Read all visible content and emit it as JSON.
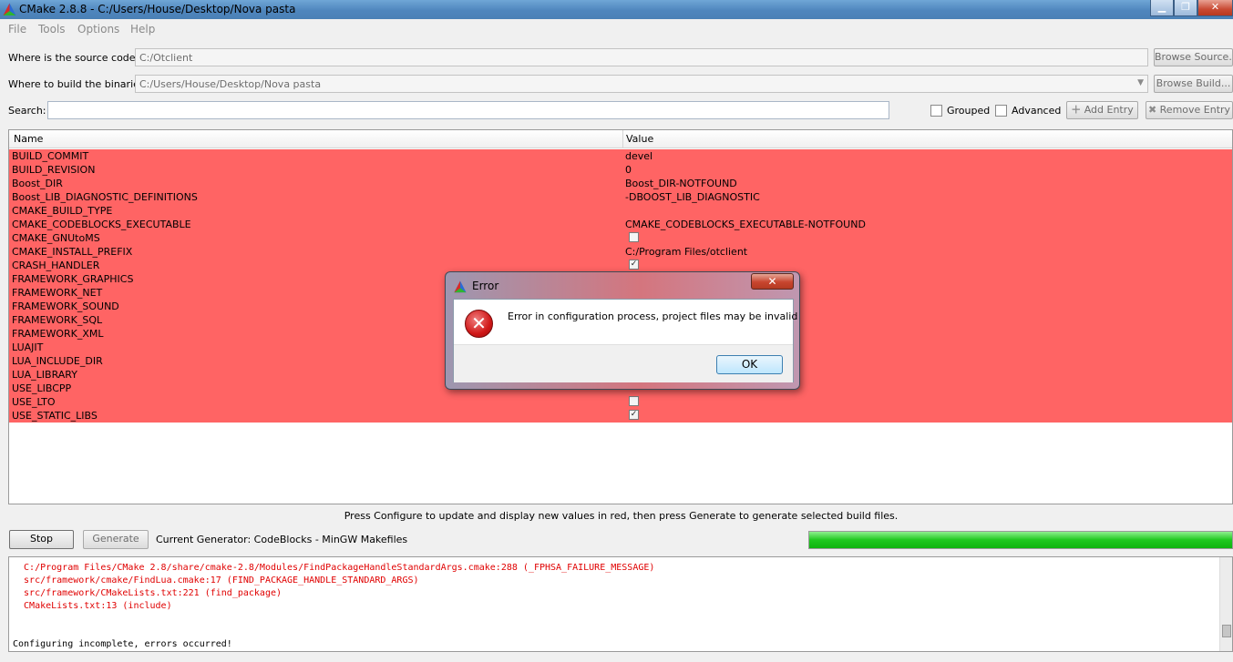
{
  "window": {
    "title": "CMake 2.8.8 - C:/Users/House/Desktop/Nova pasta"
  },
  "menu": [
    "File",
    "Tools",
    "Options",
    "Help"
  ],
  "source": {
    "label": "Where is the source code:",
    "value": "C:/Otclient",
    "browse": "Browse Source..."
  },
  "build": {
    "label": "Where to build the binaries:",
    "value": "C:/Users/House/Desktop/Nova pasta",
    "browse": "Browse Build..."
  },
  "search": {
    "label": "Search:",
    "value": ""
  },
  "options": {
    "grouped": "Grouped",
    "advanced": "Advanced",
    "add_entry": "Add Entry",
    "remove_entry": "Remove Entry"
  },
  "table": {
    "headers": {
      "name": "Name",
      "value": "Value"
    },
    "rows": [
      {
        "name": "BUILD_COMMIT",
        "value": "devel",
        "type": "text"
      },
      {
        "name": "BUILD_REVISION",
        "value": "0",
        "type": "text"
      },
      {
        "name": "Boost_DIR",
        "value": "Boost_DIR-NOTFOUND",
        "type": "text"
      },
      {
        "name": "Boost_LIB_DIAGNOSTIC_DEFINITIONS",
        "value": "-DBOOST_LIB_DIAGNOSTIC",
        "type": "text"
      },
      {
        "name": "CMAKE_BUILD_TYPE",
        "value": "",
        "type": "text"
      },
      {
        "name": "CMAKE_CODEBLOCKS_EXECUTABLE",
        "value": "CMAKE_CODEBLOCKS_EXECUTABLE-NOTFOUND",
        "type": "text"
      },
      {
        "name": "CMAKE_GNUtoMS",
        "value": false,
        "type": "bool"
      },
      {
        "name": "CMAKE_INSTALL_PREFIX",
        "value": "C:/Program Files/otclient",
        "type": "text"
      },
      {
        "name": "CRASH_HANDLER",
        "value": true,
        "type": "bool"
      },
      {
        "name": "FRAMEWORK_GRAPHICS",
        "value": "",
        "type": "text"
      },
      {
        "name": "FRAMEWORK_NET",
        "value": "",
        "type": "text"
      },
      {
        "name": "FRAMEWORK_SOUND",
        "value": "",
        "type": "text"
      },
      {
        "name": "FRAMEWORK_SQL",
        "value": "",
        "type": "text"
      },
      {
        "name": "FRAMEWORK_XML",
        "value": "",
        "type": "text"
      },
      {
        "name": "LUAJIT",
        "value": "",
        "type": "text"
      },
      {
        "name": "LUA_INCLUDE_DIR",
        "value": "",
        "type": "text"
      },
      {
        "name": "LUA_LIBRARY",
        "value": "",
        "type": "text"
      },
      {
        "name": "USE_LIBCPP",
        "value": "",
        "type": "text"
      },
      {
        "name": "USE_LTO",
        "value": false,
        "type": "bool"
      },
      {
        "name": "USE_STATIC_LIBS",
        "value": true,
        "type": "bool"
      }
    ]
  },
  "hint": "Press Configure to update and display new values in red, then press Generate to generate selected build files.",
  "actions": {
    "stop": "Stop",
    "generate": "Generate"
  },
  "generator": "Current Generator: CodeBlocks - MinGW Makefiles",
  "progress": {
    "fraction": 1.0,
    "color": "#1fc81f"
  },
  "log": [
    {
      "text": "  C:/Program Files/CMake 2.8/share/cmake-2.8/Modules/FindPackageHandleStandardArgs.cmake:288 (_FPHSA_FAILURE_MESSAGE)",
      "error": true
    },
    {
      "text": "  src/framework/cmake/FindLua.cmake:17 (FIND_PACKAGE_HANDLE_STANDARD_ARGS)",
      "error": true
    },
    {
      "text": "  src/framework/CMakeLists.txt:221 (find_package)",
      "error": true
    },
    {
      "text": "  CMakeLists.txt:13 (include)",
      "error": true
    },
    {
      "text": "Configuring incomplete, errors occurred!",
      "error": false
    }
  ],
  "dialog": {
    "title": "Error",
    "message": "Error in configuration process, project files may be invalid",
    "ok": "OK",
    "close": "✕"
  },
  "colors": {
    "row_error": "#ff6464",
    "log_error": "#e00000"
  }
}
